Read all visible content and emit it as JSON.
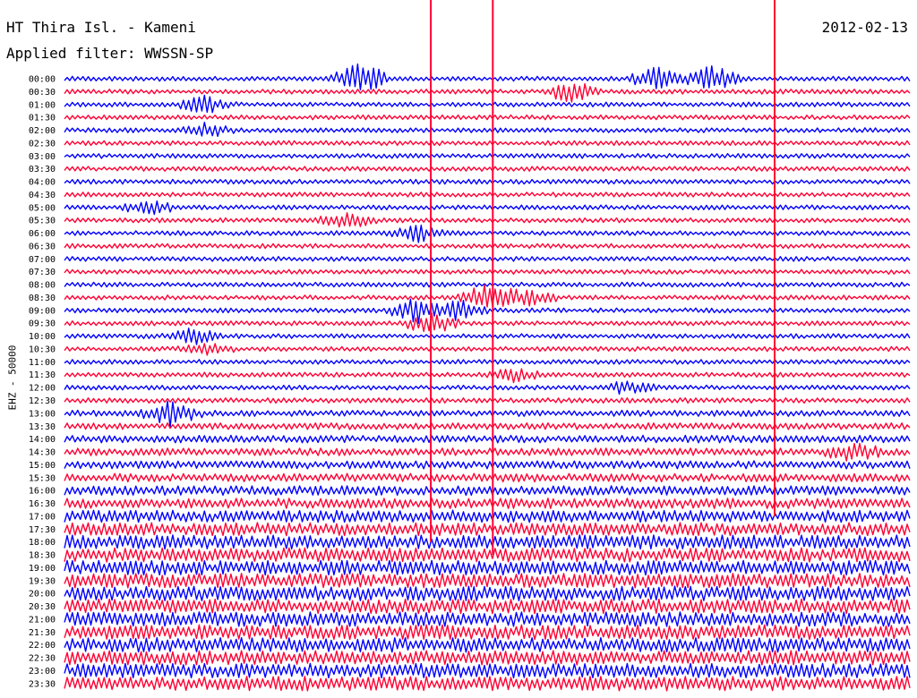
{
  "header": {
    "station": "HT Thira Isl. - Kameni",
    "filter": "Applied filter: WWSSN-SP",
    "date": "2012-02-13"
  },
  "chart_data": {
    "type": "line",
    "title": "HT Thira Isl. - Kameni",
    "subtitle": "Applied filter: WWSSN-SP",
    "ylabel": "EHZ - 50000",
    "rows": [
      "00:00",
      "00:30",
      "01:00",
      "01:30",
      "02:00",
      "02:30",
      "03:00",
      "03:30",
      "04:00",
      "04:30",
      "05:00",
      "05:30",
      "06:00",
      "06:30",
      "07:00",
      "07:30",
      "08:00",
      "08:30",
      "09:00",
      "09:30",
      "10:00",
      "10:30",
      "11:00",
      "11:30",
      "12:00",
      "12:30",
      "13:00",
      "13:30",
      "14:00",
      "14:30",
      "15:00",
      "15:30",
      "16:00",
      "16:30",
      "17:00",
      "17:30",
      "18:00",
      "18:30",
      "19:00",
      "19:30",
      "20:00",
      "20:30",
      "21:00",
      "21:30",
      "22:00",
      "22:30",
      "23:00",
      "23:30"
    ],
    "row_colors": [
      "#0000ff",
      "#ff0033"
    ],
    "noise_level": [
      1.0,
      1.0,
      1.0,
      1.0,
      1.0,
      1.0,
      1.0,
      1.0,
      1.0,
      1.0,
      1.0,
      1.0,
      1.0,
      1.0,
      1.0,
      1.0,
      1.0,
      1.0,
      1.0,
      1.0,
      1.0,
      1.0,
      1.0,
      1.0,
      1.0,
      1.1,
      1.3,
      1.4,
      1.6,
      1.6,
      1.7,
      1.8,
      2.0,
      2.2,
      2.6,
      2.8,
      3.0,
      3.0,
      3.1,
      3.1,
      3.1,
      3.1,
      3.1,
      3.1,
      3.1,
      3.1,
      3.1,
      3.1
    ],
    "events": [
      {
        "row": 0,
        "minute": 10.5,
        "amp": 8
      },
      {
        "row": 0,
        "minute": 21.0,
        "amp": 5
      },
      {
        "row": 0,
        "minute": 23.0,
        "amp": 6
      },
      {
        "row": 1,
        "minute": 18.0,
        "amp": 5
      },
      {
        "row": 2,
        "minute": 5.0,
        "amp": 4
      },
      {
        "row": 4,
        "minute": 5.0,
        "amp": 3
      },
      {
        "row": 10,
        "minute": 3.0,
        "amp": 3
      },
      {
        "row": 11,
        "minute": 10.0,
        "amp": 4
      },
      {
        "row": 12,
        "minute": 12.5,
        "amp": 4
      },
      {
        "row": 17,
        "minute": 15.0,
        "amp": 6
      },
      {
        "row": 17,
        "minute": 16.5,
        "amp": 4
      },
      {
        "row": 18,
        "minute": 12.5,
        "amp": 6
      },
      {
        "row": 18,
        "minute": 14.0,
        "amp": 5
      },
      {
        "row": 19,
        "minute": 13.0,
        "amp": 5
      },
      {
        "row": 20,
        "minute": 4.5,
        "amp": 4
      },
      {
        "row": 21,
        "minute": 5.0,
        "amp": 3
      },
      {
        "row": 23,
        "minute": 16.0,
        "amp": 3
      },
      {
        "row": 24,
        "minute": 20.0,
        "amp": 3
      },
      {
        "row": 26,
        "minute": 3.8,
        "amp": 6
      },
      {
        "row": 29,
        "minute": 28.0,
        "amp": 4
      }
    ],
    "spikes": [
      {
        "minute": 13.0,
        "from_row": 0,
        "to_row": 36
      },
      {
        "minute": 15.2,
        "from_row": 0,
        "to_row": 37
      },
      {
        "minute": 25.2,
        "from_row": 0,
        "to_row": 34
      }
    ]
  }
}
